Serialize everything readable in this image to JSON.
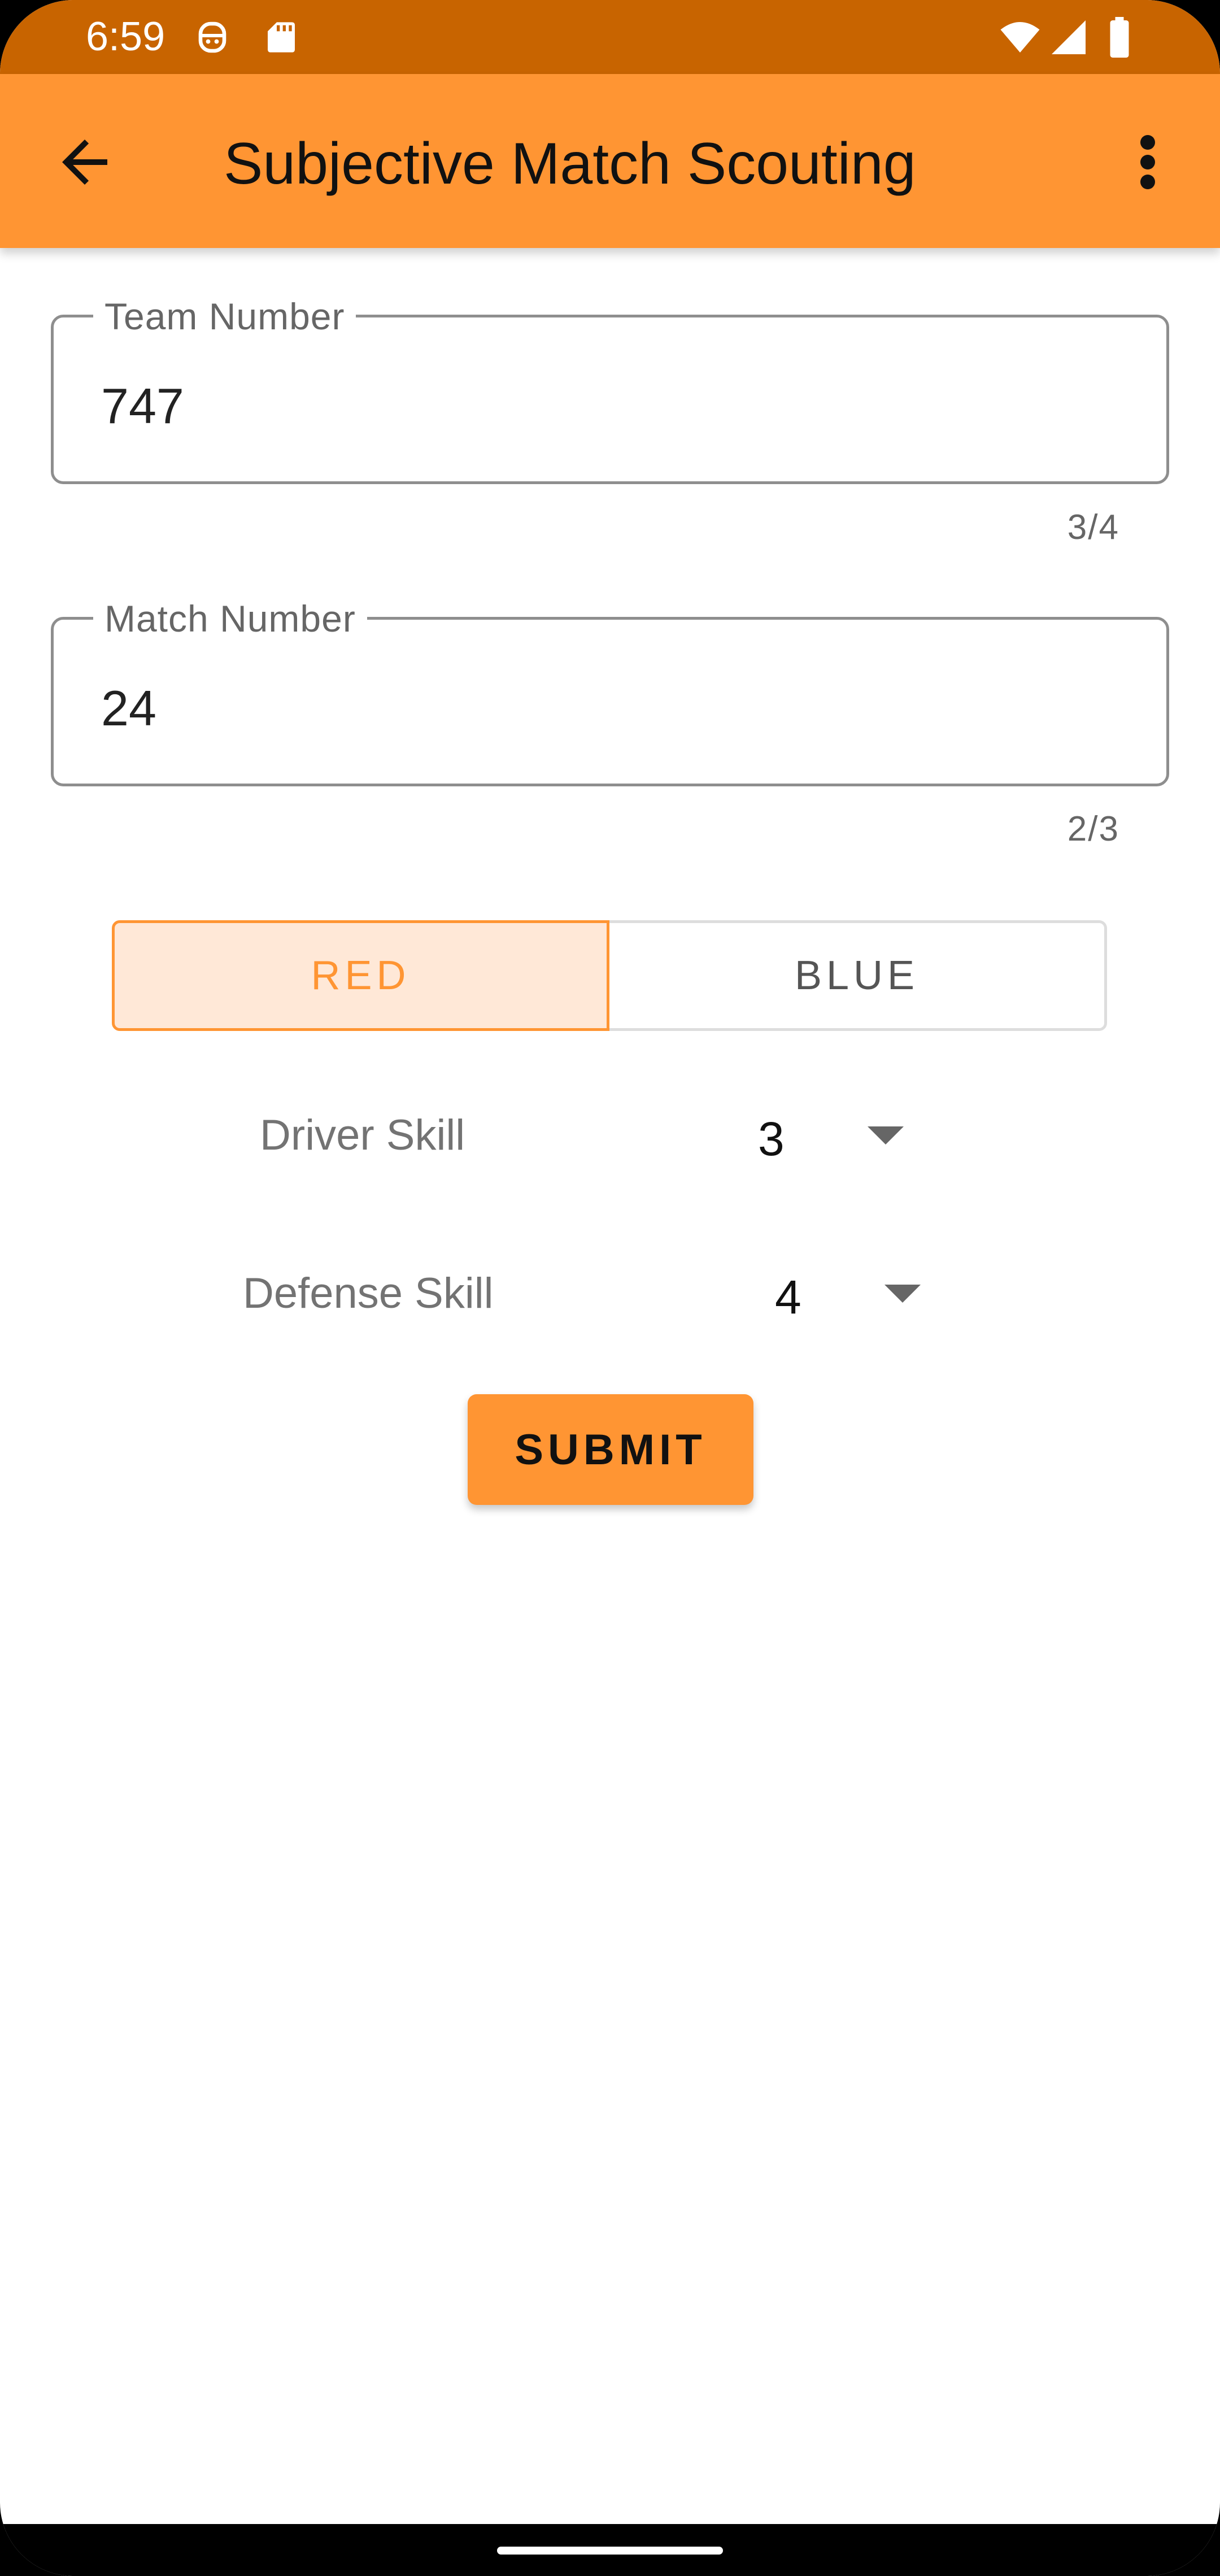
{
  "status_bar": {
    "time": "6:59",
    "icons": [
      "face-icon",
      "sd-card-icon",
      "wifi-icon",
      "signal-icon",
      "battery-icon"
    ]
  },
  "app_bar": {
    "title": "Subjective Match Scouting",
    "back_icon": "arrow-back-icon",
    "menu_icon": "more-vert-icon"
  },
  "form": {
    "team_number": {
      "label": "Team Number",
      "value": "747",
      "counter": "3/4"
    },
    "match_number": {
      "label": "Match Number",
      "value": "24",
      "counter": "2/3"
    },
    "alliance": {
      "options": [
        "RED",
        "BLUE"
      ],
      "selected": "RED"
    },
    "driver_skill": {
      "label": "Driver Skill",
      "value": "3"
    },
    "defense_skill": {
      "label": "Defense Skill",
      "value": "4"
    },
    "submit_label": "SUBMIT"
  },
  "colors": {
    "status_bar": "#C86400",
    "primary": "#FF9533",
    "selected_bg": "#FFE8D7"
  }
}
